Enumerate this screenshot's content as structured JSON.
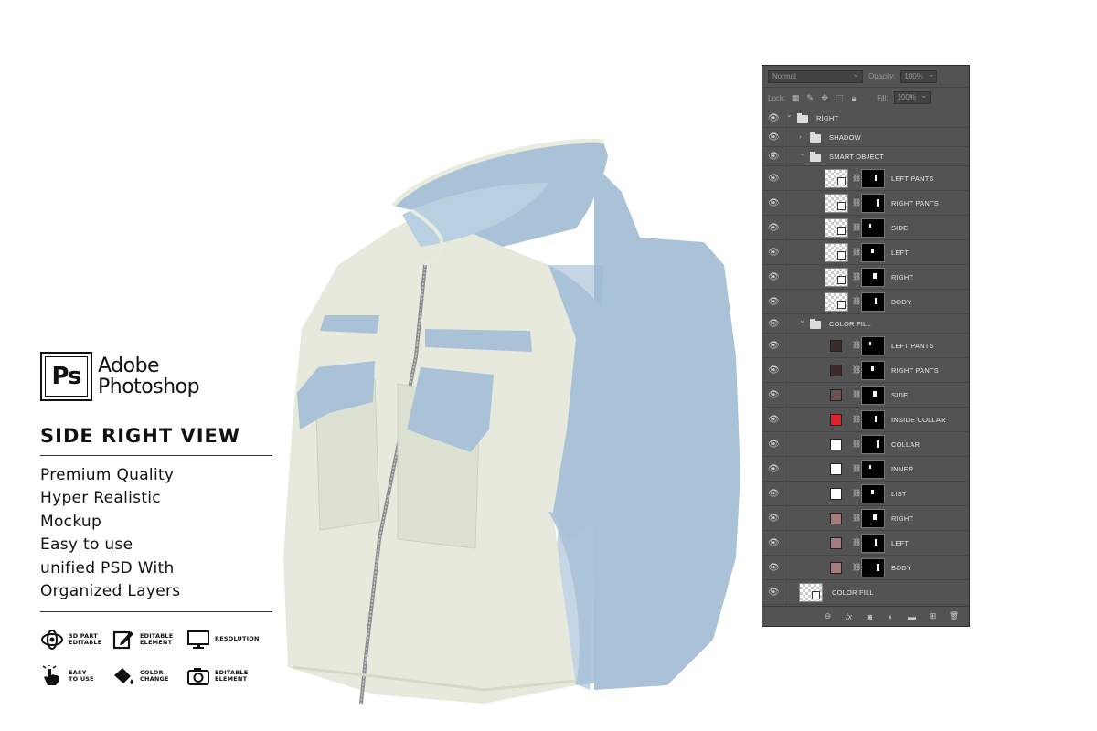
{
  "brand": {
    "logo_text": "Ps",
    "name_line1": "Adobe",
    "name_line2": "Photoshop"
  },
  "view_title": "SIDE RIGHT VIEW",
  "features": [
    "Premium Quality",
    "Hyper Realistic",
    "Mockup",
    "Easy to use",
    "unified PSD With",
    "Organized Layers"
  ],
  "badges": [
    {
      "icon": "3d-part-icon",
      "line1": "3D PART",
      "line2": "EDITABLE"
    },
    {
      "icon": "edit-icon",
      "line1": "EDITABLE",
      "line2": "ELEMENT"
    },
    {
      "icon": "monitor-icon",
      "line1": "RESOLUTION",
      "line2": ""
    },
    {
      "icon": "hand-icon",
      "line1": "EASY",
      "line2": "TO USE"
    },
    {
      "icon": "paint-bucket-icon",
      "line1": "COLOR",
      "line2": "CHANGE"
    },
    {
      "icon": "camera-icon",
      "line1": "EDITABLE",
      "line2": "ELEMENT"
    }
  ],
  "panel": {
    "blend_mode": "Normal",
    "opacity_label": "Opacity:",
    "opacity_value": "100%",
    "lock_label": "Lock:",
    "fill_label": "Fill:",
    "fill_value": "100%",
    "layers": [
      {
        "name": "RIGHT",
        "kind": "group",
        "indent": 0,
        "expanded": true
      },
      {
        "name": "SHADOW",
        "kind": "group",
        "indent": 1,
        "expanded": false
      },
      {
        "name": "SMART OBJECT",
        "kind": "group",
        "indent": 1,
        "expanded": true
      },
      {
        "name": "LEFT PANTS",
        "kind": "smart",
        "indent": 2
      },
      {
        "name": "RIGHT PANTS",
        "kind": "smart",
        "indent": 2
      },
      {
        "name": "SIDE",
        "kind": "smart",
        "indent": 2
      },
      {
        "name": "LEFT",
        "kind": "smart",
        "indent": 2
      },
      {
        "name": "RIGHT",
        "kind": "smart",
        "indent": 2
      },
      {
        "name": "BODY",
        "kind": "smart",
        "indent": 2
      },
      {
        "name": "COLOR FILL",
        "kind": "group",
        "indent": 1,
        "expanded": true
      },
      {
        "name": "LEFT PANTS",
        "kind": "fill",
        "indent": 2,
        "color": "#3d2a2a"
      },
      {
        "name": "RIGHT PANTS",
        "kind": "fill",
        "indent": 2,
        "color": "#3d2a2a"
      },
      {
        "name": "SIDE",
        "kind": "fill",
        "indent": 2,
        "color": "#6e5050"
      },
      {
        "name": "INSIDE COLLAR",
        "kind": "fill",
        "indent": 2,
        "color": "#e0202a"
      },
      {
        "name": "COLLAR",
        "kind": "fill",
        "indent": 2,
        "color": "#ffffff"
      },
      {
        "name": "INNER",
        "kind": "fill",
        "indent": 2,
        "color": "#ffffff"
      },
      {
        "name": "LIST",
        "kind": "fill",
        "indent": 2,
        "color": "#ffffff"
      },
      {
        "name": "RIGHT",
        "kind": "fill",
        "indent": 2,
        "color": "#a87b7b"
      },
      {
        "name": "LEFT",
        "kind": "fill",
        "indent": 2,
        "color": "#a87b7b"
      },
      {
        "name": "BODY",
        "kind": "fill",
        "indent": 2,
        "color": "#a87b7b"
      },
      {
        "name": "COLOR FILL",
        "kind": "image",
        "indent": 0
      }
    ]
  },
  "colors": {
    "vest_body": "#e6e9dc",
    "vest_accent": "#a9c2d8",
    "panel_bg": "#535353"
  }
}
